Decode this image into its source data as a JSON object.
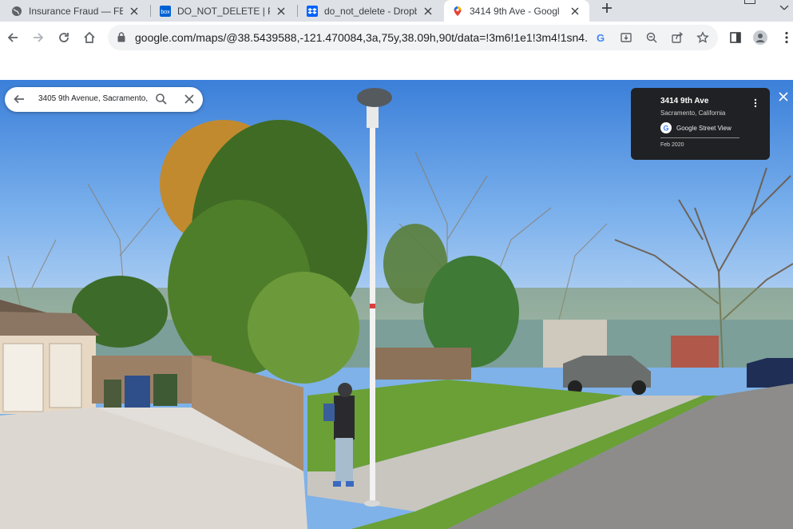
{
  "browser": {
    "tabs": [
      {
        "title": "Insurance Fraud — FB",
        "icon": "globe-icon"
      },
      {
        "title": "DO_NOT_DELETE | Pov",
        "icon": "box-icon"
      },
      {
        "title": "do_not_delete - Dropb",
        "icon": "dropbox-icon"
      },
      {
        "title": "3414 9th Ave - Googl",
        "icon": "maps-pin-icon",
        "active": true
      }
    ],
    "url": "google.com/maps/@38.5439588,-121.470084,3a,75y,38.09h,90t/data=!3m6!1e1!3m4!1sn4..."
  },
  "maps": {
    "search_query": "3405 9th Avenue, Sacramento,",
    "info": {
      "address": "3414 9th Ave",
      "city": "Sacramento, California",
      "source": "Google Street View",
      "date": "Feb 2020"
    }
  },
  "colors": {
    "tabbar": "#dee1e6",
    "card": "#202124",
    "sky": "#6fa6e6"
  }
}
